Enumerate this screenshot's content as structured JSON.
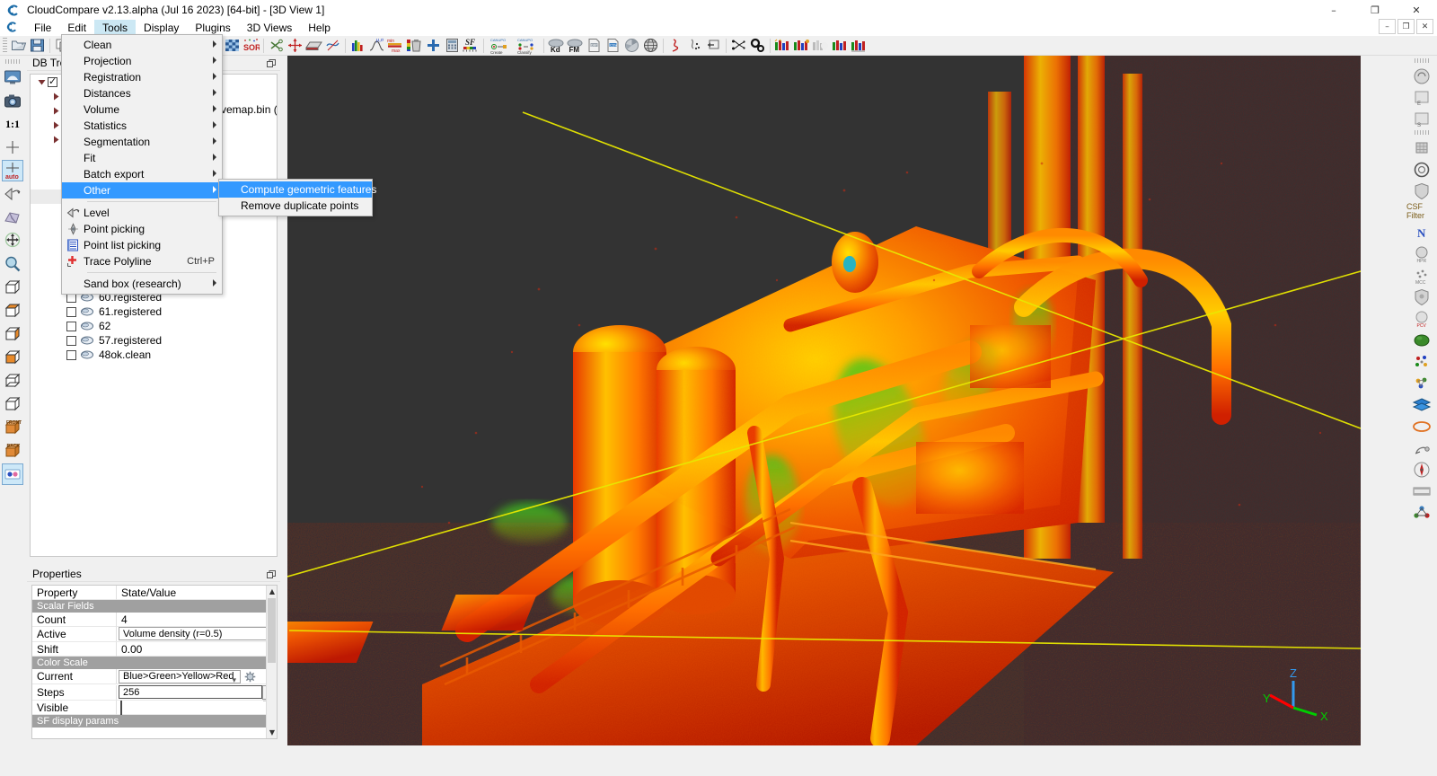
{
  "window": {
    "app_icon": "cloudcompare-icon",
    "title": "CloudCompare v2.13.alpha (Jul 16 2023) [64-bit] - [3D View 1]",
    "minimize": "–",
    "maximize": "❐",
    "close": "✕",
    "sub_minimize": "–",
    "sub_restore": "❐",
    "sub_close": "✕"
  },
  "menubar": {
    "items": [
      {
        "label": "File",
        "active": false
      },
      {
        "label": "Edit",
        "active": false
      },
      {
        "label": "Tools",
        "active": true
      },
      {
        "label": "Display",
        "active": false
      },
      {
        "label": "Plugins",
        "active": false
      },
      {
        "label": "3D Views",
        "active": false
      },
      {
        "label": "Help",
        "active": false
      }
    ]
  },
  "tools_menu": {
    "items": [
      {
        "label": "Clean",
        "submenu": true,
        "icon": "",
        "shortcut": ""
      },
      {
        "label": "Projection",
        "submenu": true,
        "icon": "",
        "shortcut": ""
      },
      {
        "label": "Registration",
        "submenu": true,
        "icon": "",
        "shortcut": ""
      },
      {
        "label": "Distances",
        "submenu": true,
        "icon": "",
        "shortcut": ""
      },
      {
        "label": "Volume",
        "submenu": true,
        "icon": "",
        "shortcut": ""
      },
      {
        "label": "Statistics",
        "submenu": true,
        "icon": "",
        "shortcut": ""
      },
      {
        "label": "Segmentation",
        "submenu": true,
        "icon": "",
        "shortcut": ""
      },
      {
        "label": "Fit",
        "submenu": true,
        "icon": "",
        "shortcut": ""
      },
      {
        "label": "Batch export",
        "submenu": true,
        "icon": "",
        "shortcut": ""
      },
      {
        "label": "Other",
        "submenu": true,
        "icon": "",
        "shortcut": "",
        "highlighted": true
      },
      {
        "separator": true
      },
      {
        "label": "Level",
        "submenu": false,
        "icon": "level-icon",
        "shortcut": ""
      },
      {
        "label": "Point picking",
        "submenu": false,
        "icon": "point-picking-icon",
        "shortcut": ""
      },
      {
        "label": "Point list picking",
        "submenu": false,
        "icon": "point-list-picking-icon",
        "shortcut": ""
      },
      {
        "label": "Trace Polyline",
        "submenu": false,
        "icon": "trace-polyline-icon",
        "shortcut": "Ctrl+P"
      },
      {
        "separator": true
      },
      {
        "label": "Sand box (research)",
        "submenu": true,
        "icon": "",
        "shortcut": ""
      }
    ]
  },
  "other_submenu": {
    "items": [
      {
        "label": "Compute geometric features",
        "highlighted": true
      },
      {
        "label": "Remove duplicate points",
        "highlighted": false
      }
    ]
  },
  "toolbar": {
    "groups": [
      {
        "buttons": [
          {
            "name": "open-icon",
            "label": "Open"
          },
          {
            "name": "save-icon",
            "label": "Save"
          }
        ]
      },
      {
        "buttons": [
          {
            "name": "clone-icon",
            "label": "Clone"
          },
          {
            "name": "merge-icon",
            "label": "Merge"
          },
          {
            "name": "subsample-icon",
            "label": "Subsample"
          },
          {
            "name": "segment-icon",
            "label": "Segment"
          },
          {
            "name": "normals-icon",
            "label": "Compute normals"
          },
          {
            "name": "density-icon",
            "label": "Density"
          },
          {
            "name": "mesh-icon",
            "label": "Mesh"
          },
          {
            "name": "register-icon",
            "label": "Register"
          },
          {
            "name": "align-icon",
            "label": "Align"
          },
          {
            "name": "match-icon",
            "label": "Match bounding boxes"
          },
          {
            "name": "cc-compare-icon",
            "label": "Cloud/Cloud distance"
          },
          {
            "name": "filter-icon",
            "label": "Filter"
          },
          {
            "name": "sor-filter-icon",
            "label": "SOR filter"
          },
          {
            "name": "cut-icon",
            "label": "Cut"
          },
          {
            "name": "translate-rotate-icon",
            "label": "Translate/Rotate"
          },
          {
            "name": "crop-box-icon",
            "label": "Crop"
          },
          {
            "name": "fit-plane-icon",
            "label": "Fit plane"
          }
        ]
      },
      {
        "buttons": [
          {
            "name": "histogram-icon",
            "label": "Histogram"
          },
          {
            "name": "gauss-filter-icon",
            "label": "Gaussian filter"
          },
          {
            "name": "minmax-icon",
            "label": "Set SF min/max"
          },
          {
            "name": "delete-sf-icon",
            "label": "Delete scalar field"
          },
          {
            "name": "add-sf-icon",
            "label": "Add constant SF"
          },
          {
            "name": "sf-arithmetic-icon",
            "label": "Scalar field arithmetic"
          },
          {
            "name": "sf-gradient-icon",
            "label": "SF gradient"
          }
        ]
      },
      {
        "buttons": [
          {
            "name": "canupo-create-icon",
            "label": "CANUPO Create"
          },
          {
            "name": "canupo-classify-icon",
            "label": "CANUPO Classify"
          }
        ]
      },
      {
        "buttons": [
          {
            "name": "kd-tree-icon",
            "label": "Kd"
          },
          {
            "name": "fm-icon",
            "label": "FM"
          },
          {
            "name": "export-dip-icon",
            "label": "Export DIP"
          },
          {
            "name": "export-csv-icon",
            "label": "Export CSV"
          },
          {
            "name": "facets-icon",
            "label": "Facets"
          },
          {
            "name": "globe-icon",
            "label": "Globe"
          }
        ]
      },
      {
        "buttons": [
          {
            "name": "curve-icon",
            "label": "Curvature"
          },
          {
            "name": "scatter-icon",
            "label": "Scatter"
          },
          {
            "name": "section-icon",
            "label": "Section extraction"
          }
        ]
      },
      {
        "buttons": [
          {
            "name": "classify-icon",
            "label": "Classify"
          },
          {
            "name": "settings-gears-icon",
            "label": "Settings"
          }
        ]
      },
      {
        "buttons": [
          {
            "name": "rgb-bars-1-icon",
            "label": "RGB 1"
          },
          {
            "name": "rgb-bars-2-icon",
            "label": "RGB 2"
          },
          {
            "name": "gray-bars-icon",
            "label": "Gray"
          },
          {
            "name": "rgb-bars-3-icon",
            "label": "RGB 3"
          },
          {
            "name": "rgb-bars-4-icon",
            "label": "RGB 4"
          }
        ]
      }
    ]
  },
  "left_toolbar": {
    "buttons": [
      {
        "name": "full-screen-icon",
        "label": "Toggle full screen",
        "selected": false
      },
      {
        "name": "snapshot-icon",
        "label": "Snapshot",
        "selected": false
      },
      {
        "name": "zoom-1-1-icon",
        "label": "1:1",
        "selected": false,
        "text": "1:1"
      },
      {
        "name": "pivot-center-icon",
        "label": "Set pivot always on",
        "selected": false
      },
      {
        "name": "pivot-auto-icon",
        "label": "Auto pivot",
        "selected": true,
        "text": "auto"
      },
      {
        "name": "camera-orbit-icon",
        "label": "Camera/Object centered rotation",
        "selected": false
      },
      {
        "name": "ortho-perspective-icon",
        "label": "Perspective",
        "selected": false
      },
      {
        "name": "move-icon",
        "label": "Move",
        "selected": false
      },
      {
        "name": "zoom-icon",
        "label": "Zoom",
        "selected": false
      },
      {
        "name": "view-default-icon",
        "label": "Default view",
        "selected": false
      },
      {
        "name": "view-top-icon",
        "label": "Top view",
        "selected": false
      },
      {
        "name": "view-left-icon",
        "label": "Left view",
        "selected": false
      },
      {
        "name": "view-right-icon",
        "label": "Right view",
        "selected": false
      },
      {
        "name": "view-bottom-icon",
        "label": "Bottom view",
        "selected": false
      },
      {
        "name": "view-iso-icon",
        "label": "Iso view",
        "selected": false
      },
      {
        "name": "view-front-icon",
        "label": "Front view",
        "selected": false,
        "text": "FRONT"
      },
      {
        "name": "view-back-icon",
        "label": "Back view",
        "selected": false,
        "text": "BACK"
      },
      {
        "name": "stereo-icon",
        "label": "Stereo mode",
        "selected": false
      }
    ]
  },
  "right_toolbar": {
    "csf_label": "CSF Filter",
    "n_label": "N",
    "buttons": [
      {
        "name": "plugin-circle-icon",
        "label": "Plugin"
      },
      {
        "name": "plugin-e-icon",
        "label": "Plugin E"
      },
      {
        "name": "plugin-s-icon",
        "label": "Plugin S"
      },
      {
        "name": "plugin-grid-icon",
        "label": "Plugin grid"
      },
      {
        "name": "plugin-lens-icon",
        "label": "Plugin lens"
      },
      {
        "name": "plugin-shield-icon",
        "label": "Plugin shield"
      },
      {
        "name": "csf-filter-icon",
        "label": "CSF Filter"
      },
      {
        "name": "normals-n-icon",
        "label": "N"
      },
      {
        "name": "hpr-icon",
        "label": "HPR"
      },
      {
        "name": "mcc-icon",
        "label": "MCC"
      },
      {
        "name": "shield2-icon",
        "label": "Shield"
      },
      {
        "name": "pcv-icon",
        "label": "PCV"
      },
      {
        "name": "poisson-icon",
        "label": "Poisson recon"
      },
      {
        "name": "ransac-icon",
        "label": "RANSAC SD"
      },
      {
        "name": "qm3c2-icon",
        "label": "M3C2"
      },
      {
        "name": "layers-icon",
        "label": "Layers"
      },
      {
        "name": "ellipse-icon",
        "label": "Ellipse"
      },
      {
        "name": "broom-icon",
        "label": "Broom"
      },
      {
        "name": "compass-icon",
        "label": "Compass"
      },
      {
        "name": "animation-icon",
        "label": "Animation"
      },
      {
        "name": "cork-icon",
        "label": "Cork"
      }
    ]
  },
  "dbtree": {
    "title": "DB Tree",
    "items": [
      {
        "depth": 0,
        "label": "",
        "checkbox": true,
        "checked": true,
        "expander": "down",
        "icon": "group-icon",
        "selected": false
      },
      {
        "depth": 1,
        "label": "",
        "checkbox": false,
        "checked": false,
        "expander": "right",
        "icon": "cloud-icon",
        "selected": false
      },
      {
        "depth": 1,
        "label": "",
        "checkbox": false,
        "checked": false,
        "expander": "right",
        "icon": "cloud-icon",
        "selected": false
      },
      {
        "depth": 1,
        "label": "",
        "checkbox": false,
        "checked": false,
        "expander": "right",
        "icon": "cloud-icon",
        "selected": false
      },
      {
        "depth": 1,
        "label": "",
        "checkbox": false,
        "checked": false,
        "expander": "right",
        "icon": "cloud-icon",
        "selected": false
      },
      {
        "depth": 1,
        "label": "",
        "checkbox": true,
        "checked": false,
        "expander": "",
        "icon": "cloud-icon",
        "selected": false
      },
      {
        "depth": 1,
        "label": "",
        "checkbox": true,
        "checked": false,
        "expander": "",
        "icon": "cloud-icon",
        "selected": false
      },
      {
        "depth": 1,
        "label": "",
        "checkbox": true,
        "checked": false,
        "expander": "",
        "icon": "cloud-icon",
        "selected": false
      },
      {
        "depth": 1,
        "label": "",
        "checkbox": true,
        "checked": false,
        "expander": "",
        "icon": "cloud-icon",
        "selected": true
      },
      {
        "depth": 1,
        "label": "",
        "checkbox": true,
        "checked": false,
        "expander": "",
        "icon": "cloud-icon",
        "selected": false
      },
      {
        "depth": 1,
        "label": "",
        "checkbox": true,
        "checked": false,
        "expander": "",
        "icon": "cloud-icon",
        "selected": false
      },
      {
        "depth": 1,
        "label": "",
        "checkbox": true,
        "checked": false,
        "expander": "",
        "icon": "cloud-icon",
        "selected": false
      },
      {
        "depth": 1,
        "label": "",
        "checkbox": true,
        "checked": false,
        "expander": "",
        "icon": "cloud-icon",
        "selected": false
      },
      {
        "depth": 1,
        "label": "",
        "checkbox": true,
        "checked": false,
        "expander": "",
        "icon": "cloud-icon",
        "selected": false
      },
      {
        "depth": 1,
        "label": "",
        "checkbox": true,
        "checked": false,
        "expander": "",
        "icon": "cloud-icon",
        "selected": false
      },
      {
        "depth": 1,
        "label": "60.registered",
        "checkbox": true,
        "checked": false,
        "expander": "",
        "icon": "cloud-icon",
        "selected": false
      },
      {
        "depth": 1,
        "label": "61.registered",
        "checkbox": true,
        "checked": false,
        "expander": "",
        "icon": "cloud-icon",
        "selected": false
      },
      {
        "depth": 1,
        "label": "62",
        "checkbox": true,
        "checked": false,
        "expander": "",
        "icon": "cloud-icon",
        "selected": false
      },
      {
        "depth": 1,
        "label": "57.registered",
        "checkbox": true,
        "checked": false,
        "expander": "",
        "icon": "cloud-icon",
        "selected": false
      },
      {
        "depth": 1,
        "label": "48ok.clean",
        "checkbox": true,
        "checked": false,
        "expander": "",
        "icon": "cloud-icon",
        "selected": false
      }
    ],
    "partial_label": "vemap.bin (..."
  },
  "properties": {
    "title": "Properties",
    "header": {
      "key": "Property",
      "value": "State/Value"
    },
    "rows": [
      {
        "type": "section",
        "label": "Scalar Fields"
      },
      {
        "type": "text",
        "key": "Count",
        "value": "4"
      },
      {
        "type": "combo",
        "key": "Active",
        "value": "Volume density (r=0.5)"
      },
      {
        "type": "text",
        "key": "Shift",
        "value": "0.00"
      },
      {
        "type": "section",
        "label": "Color Scale"
      },
      {
        "type": "combo-btn",
        "key": "Current",
        "value": "Blue>Green>Yellow>Red"
      },
      {
        "type": "spin",
        "key": "Steps",
        "value": "256"
      },
      {
        "type": "checkbox",
        "key": "Visible",
        "value": "",
        "checked": false
      },
      {
        "type": "section",
        "label": "SF display params"
      }
    ]
  },
  "view3d": {
    "background_color": "#333333",
    "axis": {
      "x_label": "X",
      "y_label": "Y",
      "z_label": "Z",
      "x_color": "#ff0000",
      "y_color": "#00cc00",
      "z_color": "#3399ee"
    },
    "guideline_color": "#e8e800",
    "colorscale": "Blue>Green>Yellow>Red"
  }
}
